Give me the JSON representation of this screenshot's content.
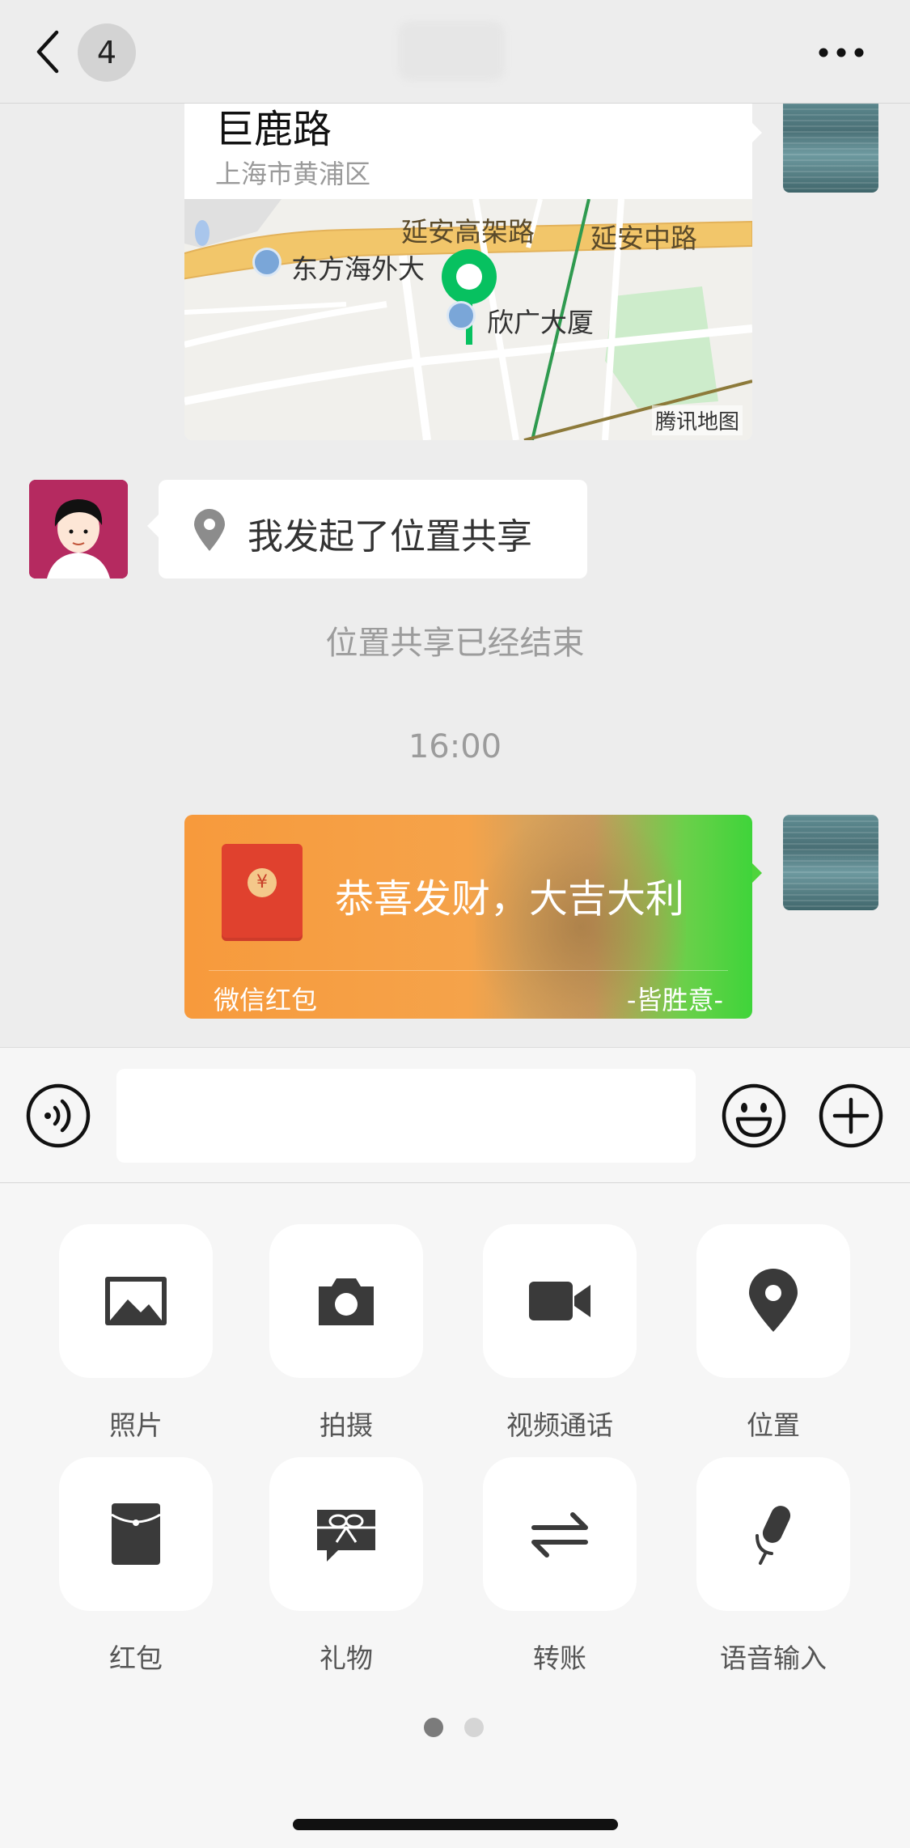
{
  "header": {
    "unread_count": "4",
    "icons": {
      "back": "chevron-left-icon",
      "more": "more-dots-icon"
    }
  },
  "messages": {
    "location": {
      "name": "巨鹿路",
      "address": "上海市黄浦区",
      "map": {
        "labels": [
          "延安高架路",
          "延安中路",
          "东方海外大",
          "欣广大厦"
        ],
        "brand": "腾讯地图"
      }
    },
    "location_share": {
      "text": "我发起了位置共享",
      "icon": "location-pin-icon"
    },
    "share_ended": "位置共享已经结束",
    "timestamp": "16:00",
    "red_packet": {
      "title": "恭喜发财，大吉大利",
      "label": "微信红包",
      "signature": "-皆胜意-",
      "coin_symbol": "¥"
    }
  },
  "input_bar": {
    "placeholder": "",
    "icons": {
      "voice": "voice-icon",
      "emoji": "emoji-icon",
      "plus": "plus-icon"
    }
  },
  "tools": [
    {
      "label": "照片",
      "icon": "photo-icon"
    },
    {
      "label": "拍摄",
      "icon": "camera-icon"
    },
    {
      "label": "视频通话",
      "icon": "video-call-icon"
    },
    {
      "label": "位置",
      "icon": "location-icon"
    },
    {
      "label": "红包",
      "icon": "red-packet-icon"
    },
    {
      "label": "礼物",
      "icon": "gift-icon"
    },
    {
      "label": "转账",
      "icon": "transfer-icon"
    },
    {
      "label": "语音输入",
      "icon": "microphone-icon"
    }
  ],
  "pagination": {
    "current": 1,
    "total": 2
  }
}
